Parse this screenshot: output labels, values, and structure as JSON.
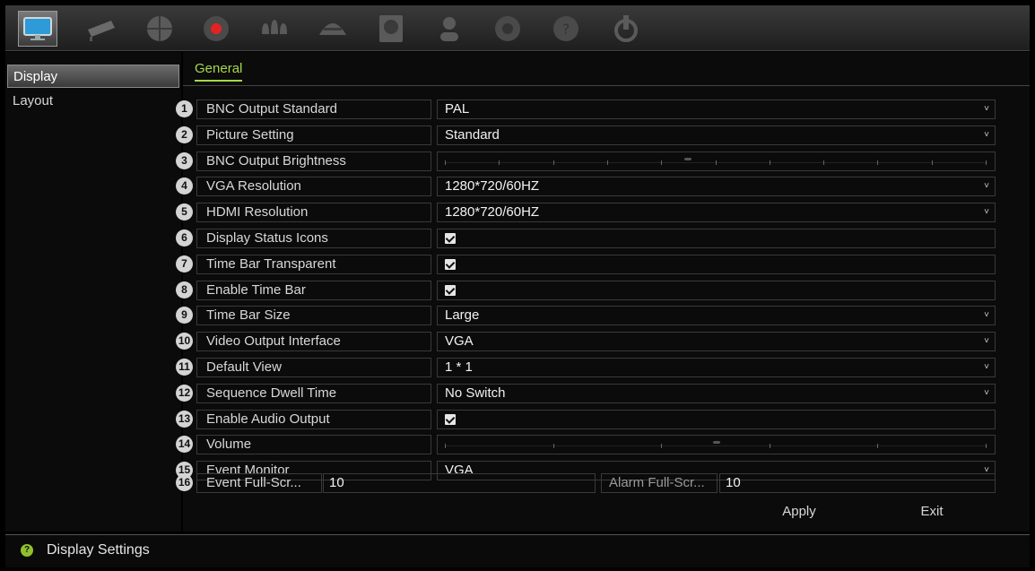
{
  "top_menu": [
    {
      "icon": "monitor-icon",
      "active": true
    },
    {
      "icon": "camera-icon",
      "active": false
    },
    {
      "icon": "network-icon",
      "active": false
    },
    {
      "icon": "record-icon",
      "active": false
    },
    {
      "icon": "alarm-icon",
      "active": false
    },
    {
      "icon": "device-icon",
      "active": false
    },
    {
      "icon": "storage-icon",
      "active": false
    },
    {
      "icon": "user-icon",
      "active": false
    },
    {
      "icon": "system-icon",
      "active": false
    },
    {
      "icon": "help-icon",
      "active": false
    },
    {
      "icon": "power-icon",
      "active": false
    }
  ],
  "sidebar": {
    "items": [
      {
        "label": "Display",
        "active": true
      },
      {
        "label": "Layout",
        "active": false
      }
    ]
  },
  "tab": {
    "label": "General"
  },
  "settings": [
    {
      "num": "1",
      "label": "BNC Output Standard",
      "type": "dropdown",
      "value": "PAL"
    },
    {
      "num": "2",
      "label": "Picture Setting",
      "type": "dropdown",
      "value": "Standard"
    },
    {
      "num": "3",
      "label": "BNC Output Brightness",
      "type": "slider"
    },
    {
      "num": "4",
      "label": "VGA Resolution",
      "type": "dropdown",
      "value": "1280*720/60HZ"
    },
    {
      "num": "5",
      "label": "HDMI Resolution",
      "type": "dropdown",
      "value": "1280*720/60HZ"
    },
    {
      "num": "6",
      "label": "Display Status Icons",
      "type": "checkbox",
      "checked": true
    },
    {
      "num": "7",
      "label": "Time Bar Transparent",
      "type": "checkbox",
      "checked": true
    },
    {
      "num": "8",
      "label": "Enable Time Bar",
      "type": "checkbox",
      "checked": true
    },
    {
      "num": "9",
      "label": "Time Bar Size",
      "type": "dropdown",
      "value": "Large"
    },
    {
      "num": "10",
      "label": "Video Output Interface",
      "type": "dropdown",
      "value": "VGA"
    },
    {
      "num": "11",
      "label": "Default View",
      "type": "dropdown",
      "value": "1 * 1"
    },
    {
      "num": "12",
      "label": "Sequence Dwell Time",
      "type": "dropdown",
      "value": "No Switch"
    },
    {
      "num": "13",
      "label": "Enable Audio Output",
      "type": "checkbox",
      "checked": true
    },
    {
      "num": "14",
      "label": "Volume",
      "type": "slider"
    },
    {
      "num": "15",
      "label": "Event Monitor",
      "type": "dropdown",
      "value": "VGA"
    }
  ],
  "event_row": {
    "num": "16",
    "event_label": "Event Full-Scr...",
    "event_value": "10",
    "alarm_label": "Alarm Full-Scr...",
    "alarm_value": "10"
  },
  "buttons": {
    "apply": "Apply",
    "exit": "Exit"
  },
  "status": {
    "text": "Display Settings",
    "icon": "help-icon"
  }
}
